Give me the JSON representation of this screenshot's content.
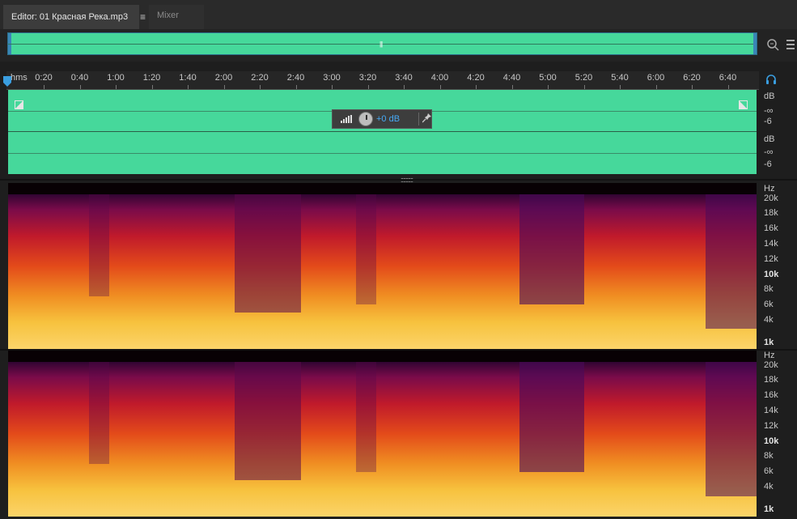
{
  "tabs": {
    "editor": "Editor: 01 Красная Река.mp3",
    "mixer": "Mixer"
  },
  "icons": {
    "menu": "hamburger-icon",
    "zoom": "zoom-icon",
    "list": "list-icon",
    "headphones": "headphones-icon",
    "pin": "pin-icon"
  },
  "ruler": {
    "unit": "hms",
    "ticks": [
      "0:20",
      "0:40",
      "1:00",
      "1:20",
      "1:40",
      "2:00",
      "2:20",
      "2:40",
      "3:00",
      "3:20",
      "3:40",
      "4:00",
      "4:20",
      "4:40",
      "5:00",
      "5:20",
      "5:40",
      "6:00",
      "6:20",
      "6:40"
    ]
  },
  "hud": {
    "gain": "+0 dB"
  },
  "db_scale": {
    "top": [
      "dB",
      "-∞",
      "-6"
    ],
    "bottom": [
      "dB",
      "-∞",
      "-6"
    ]
  },
  "hz_scale": [
    "Hz",
    "20k",
    "18k",
    "16k",
    "14k",
    "12k",
    "10k",
    "8k",
    "6k",
    "4k",
    "1k"
  ],
  "colors": {
    "waveform": "#46d89b",
    "accent": "#3a9ee0"
  }
}
